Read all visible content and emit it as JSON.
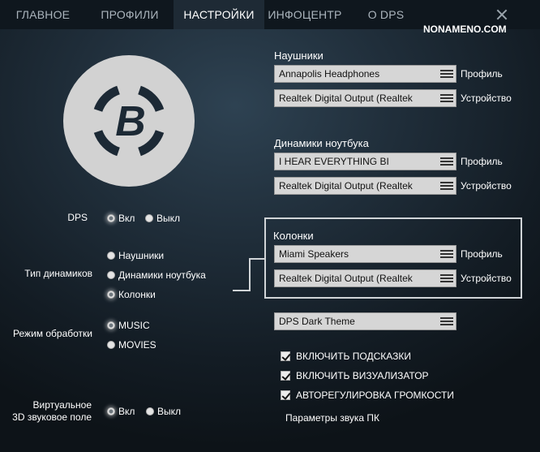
{
  "tabs": [
    {
      "label": "ГЛАВНОЕ",
      "active": false
    },
    {
      "label": "ПРОФИЛИ",
      "active": false
    },
    {
      "label": "НАСТРОЙКИ",
      "active": true
    },
    {
      "label": "ИНФОЦЕНТР",
      "active": false
    },
    {
      "label": "О DPS",
      "active": false
    }
  ],
  "watermark": "NONAMENO.COM",
  "logo": {
    "letter": "B",
    "icon": "dps-logo-icon"
  },
  "left": {
    "dps": {
      "label": "DPS",
      "on": "Вкл",
      "off": "Выкл",
      "selected": "on"
    },
    "speaker_type": {
      "label": "Тип динамиков",
      "options": [
        "Наушники",
        "Динамики ноутбука",
        "Колонки"
      ],
      "selected": "Колонки"
    },
    "processing_mode": {
      "label": "Режим обработки",
      "options": [
        "MUSIC",
        "MOVIES"
      ],
      "selected": "MUSIC"
    },
    "virtual3d": {
      "label_line1": "Виртуальное",
      "label_line2": "3D звуковое поле",
      "on": "Вкл",
      "off": "Выкл",
      "selected": "on"
    }
  },
  "headphones": {
    "title": "Наушники",
    "profile_value": "Annapolis Headphones",
    "device_value": "Realtek Digital Output (Realtek",
    "profile_label": "Профиль",
    "device_label": "Устройство"
  },
  "laptop": {
    "title": "Динамики ноутбука",
    "profile_value": "I HEAR EVERYTHING BI",
    "device_value": "Realtek Digital Output (Realtek",
    "profile_label": "Профиль",
    "device_label": "Устройство"
  },
  "speakers": {
    "title": "Колонки",
    "profile_value": "Miami Speakers",
    "device_value": "Realtek Digital Output (Realtek",
    "profile_label": "Профиль",
    "device_label": "Устройство"
  },
  "theme": {
    "value": "DPS Dark Theme"
  },
  "checks": [
    {
      "label": "ВКЛЮЧИТЬ ПОДСКАЗКИ",
      "checked": true
    },
    {
      "label": "ВКЛЮЧИТЬ ВИЗУАЛИЗАТОР",
      "checked": true
    },
    {
      "label": "АВТОРЕГУЛИРОВКА ГРОМКОСТИ",
      "checked": true
    }
  ],
  "sound_params_link": "Параметры звука ПК",
  "colors": {
    "accent": "#d0d4d7",
    "tab_active_bg": "#1e2a35",
    "topbar_bg": "#0f171e"
  }
}
